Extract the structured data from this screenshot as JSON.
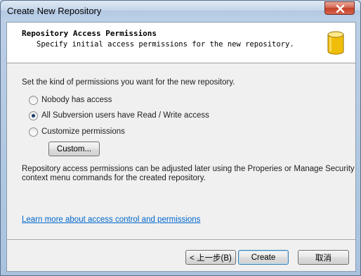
{
  "window": {
    "title": "Create New Repository"
  },
  "header": {
    "title": "Repository Access Permissions",
    "subtitle": "Specify initial access permissions for the new repository."
  },
  "prompt": "Set the kind of permissions you want for the new repository.",
  "options": [
    {
      "label": "Nobody has access",
      "checked": false
    },
    {
      "label": "All Subversion users have Read / Write access",
      "checked": true
    },
    {
      "label": "Customize permissions",
      "checked": false
    }
  ],
  "custom_button": "Custom...",
  "note_line1": "Repository access permissions can be adjusted later using the Properies or Manage Security",
  "note_line2": "context menu commands for the created repository.",
  "learn_more_link": "Learn more about access control and permissions",
  "footer": {
    "back_label": "< 上一步(B)",
    "create_label": "Create",
    "cancel_label": "取消"
  },
  "colors": {
    "link": "#0066cc",
    "close": "#c3402a",
    "icon": "#f2c400"
  },
  "icons": {
    "header": "database-icon",
    "close": "close-icon"
  }
}
